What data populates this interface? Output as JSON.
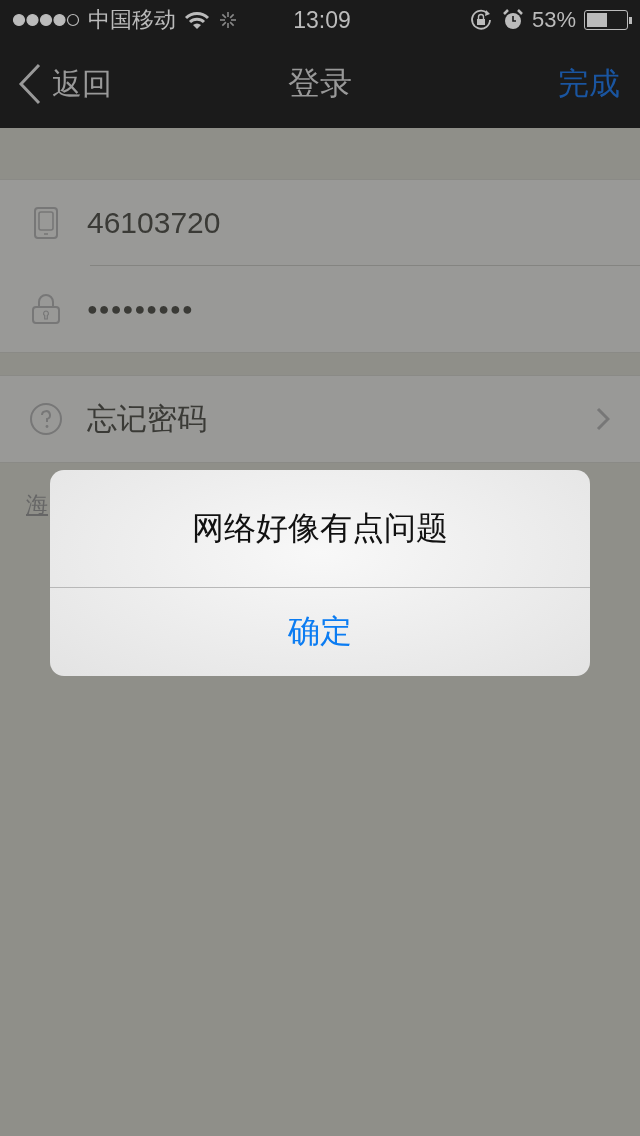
{
  "status_bar": {
    "carrier": "中国移动",
    "time": "13:09",
    "battery_percent": "53%",
    "battery": {
      "level": 0.53
    }
  },
  "nav_bar": {
    "back": "返回",
    "title": "登录",
    "done": "完成"
  },
  "login_fields": [
    {
      "kind": "phone",
      "value": "46103720"
    },
    {
      "kind": "password",
      "value": "●●●●●●●●●"
    }
  ],
  "options": [
    {
      "label": "忘记密码"
    }
  ],
  "link": {
    "label": "海"
  },
  "alert": {
    "message": "网络好像有点问题",
    "buttons": [
      "确定"
    ]
  }
}
